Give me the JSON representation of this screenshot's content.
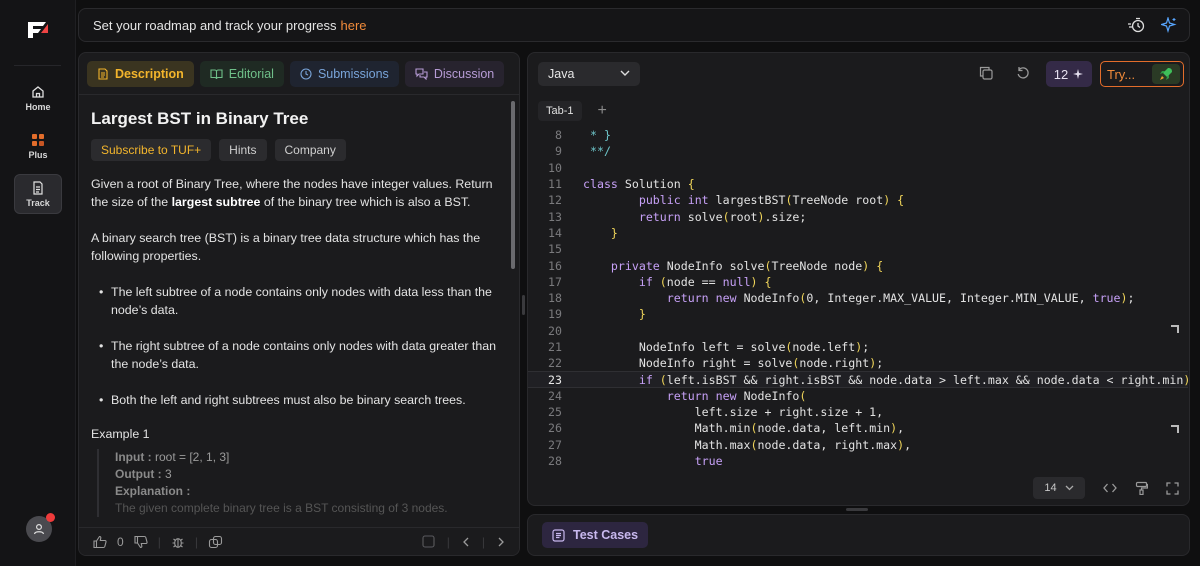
{
  "banner": {
    "text": "Set your roadmap and track your progress",
    "link": "here"
  },
  "rail": {
    "items": [
      {
        "label": "Home"
      },
      {
        "label": "Plus"
      },
      {
        "label": "Track"
      }
    ]
  },
  "tabs": {
    "description": "Description",
    "editorial": "Editorial",
    "submissions": "Submissions",
    "discussion": "Discussion"
  },
  "problem": {
    "title": "Largest BST in Binary Tree",
    "chips": {
      "subscribe": "Subscribe to TUF+",
      "hints": "Hints",
      "company": "Company"
    },
    "para1_a": "Given a root of Binary Tree, where the nodes have integer values. Return the size of the ",
    "para1_b": "largest subtree",
    "para1_c": " of the binary tree which is also a BST.",
    "para2": "A binary search tree (BST) is a binary tree data structure which has the following properties.",
    "bullets": [
      "The left subtree of a node contains only nodes with data less than the node’s data.",
      "The right subtree of a node contains only nodes with data greater than the node’s data.",
      "Both the left and right subtrees must also be binary search trees."
    ],
    "example": {
      "title": "Example 1",
      "input_label": "Input :",
      "input_value": " root = [2, 1, 3]",
      "output_label": "Output :",
      "output_value": " 3",
      "explanation_label": "Explanation :",
      "explanation_text": "The given complete binary tree is a BST consisting of 3 nodes."
    }
  },
  "footer": {
    "likes": "0"
  },
  "editor": {
    "language": "Java",
    "ai_count": "12",
    "try_label": "Try...",
    "file_tab": "Tab-1",
    "plus": "+",
    "font_size": "14",
    "current_line": 23,
    "lines": [
      {
        "n": "8",
        "t": " * }"
      },
      {
        "n": "9",
        "t": " **/"
      },
      {
        "n": "10",
        "t": ""
      },
      {
        "n": "11",
        "t": "class Solution {"
      },
      {
        "n": "12",
        "t": "        public int largestBST(TreeNode root) {"
      },
      {
        "n": "13",
        "t": "        return solve(root).size;"
      },
      {
        "n": "14",
        "t": "    }"
      },
      {
        "n": "15",
        "t": ""
      },
      {
        "n": "16",
        "t": "    private NodeInfo solve(TreeNode node) {"
      },
      {
        "n": "17",
        "t": "        if (node == null) {"
      },
      {
        "n": "18",
        "t": "            return new NodeInfo(0, Integer.MAX_VALUE, Integer.MIN_VALUE, true);"
      },
      {
        "n": "19",
        "t": "        }"
      },
      {
        "n": "20",
        "t": ""
      },
      {
        "n": "21",
        "t": "        NodeInfo left = solve(node.left);"
      },
      {
        "n": "22",
        "t": "        NodeInfo right = solve(node.right);"
      },
      {
        "n": "23",
        "t": "        if (left.isBST && right.isBST && node.data > left.max && node.data < right.min) {"
      },
      {
        "n": "24",
        "t": "            return new NodeInfo("
      },
      {
        "n": "25",
        "t": "                left.size + right.size + 1,"
      },
      {
        "n": "26",
        "t": "                Math.min(node.data, left.min),"
      },
      {
        "n": "27",
        "t": "                Math.max(node.data, right.max),"
      },
      {
        "n": "28",
        "t": "                true"
      }
    ]
  },
  "test_cases": {
    "label": "Test Cases"
  }
}
